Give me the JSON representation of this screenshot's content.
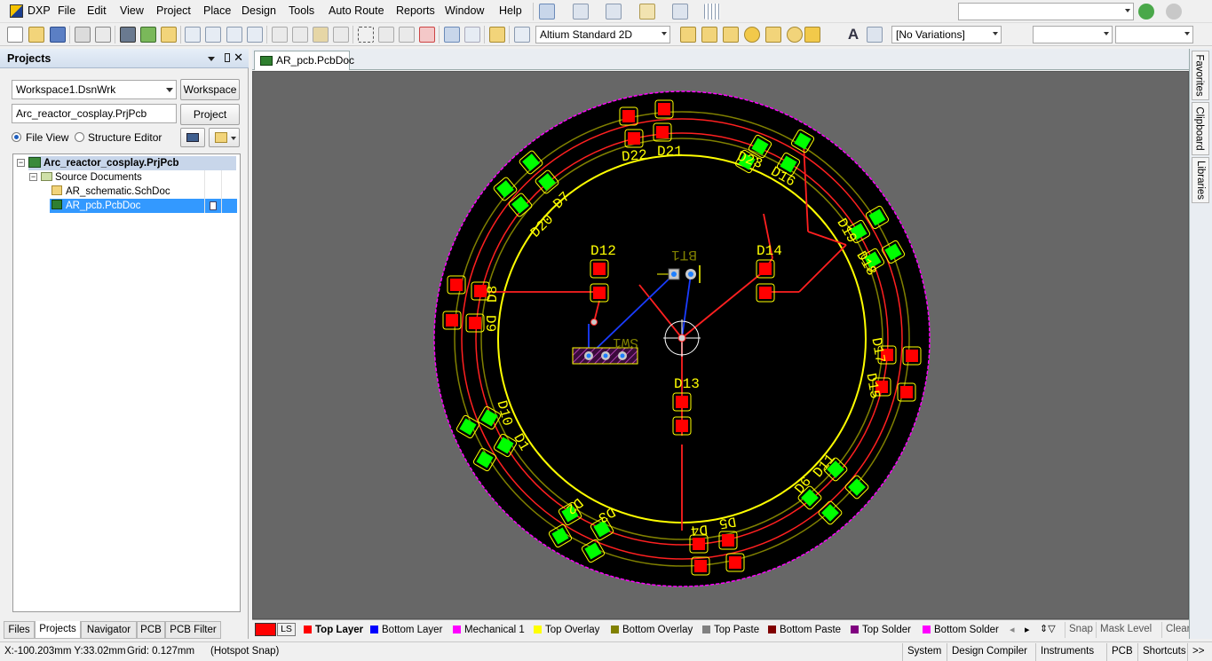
{
  "menubar": {
    "app_label": "DXP",
    "items": [
      "File",
      "Edit",
      "View",
      "Project",
      "Place",
      "Design",
      "Tools",
      "Auto Route",
      "Reports",
      "Window",
      "Help"
    ]
  },
  "toolbar": {
    "view_mode": "Altium Standard 2D",
    "variations": "[No Variations]"
  },
  "projects_panel": {
    "title": "Projects",
    "workspace_value": "Workspace1.DsnWrk",
    "workspace_button": "Workspace",
    "project_value": "Arc_reactor_cosplay.PrjPcb",
    "project_button": "Project",
    "file_view_label": "File View",
    "structure_editor_label": "Structure Editor",
    "tree": {
      "project": "Arc_reactor_cosplay.PrjPcb",
      "folder": "Source Documents",
      "schematic": "AR_schematic.SchDoc",
      "pcb": "AR_pcb.PcbDoc"
    },
    "tabs": [
      "Files",
      "Projects",
      "Navigator",
      "PCB",
      "PCB Filter"
    ],
    "active_tab": "Projects"
  },
  "document_tab": "AR_pcb.PcbDoc",
  "pcb": {
    "designators": {
      "D22": "D22",
      "D21": "D21",
      "D23": "D23",
      "D16": "D16",
      "D20": "D20",
      "D7": "D7",
      "D19": "D19",
      "D18": "D18",
      "D12": "D12",
      "BT1": "BT1",
      "D14": "D14",
      "D8": "D8",
      "D9": "D9",
      "SW1": "SW1",
      "D17": "D17",
      "D15": "D15",
      "D13": "D13",
      "D10": "D10",
      "D1": "D1",
      "D11": "D11",
      "D6": "D6",
      "D2": "D2",
      "D3": "D3",
      "D5": "D5",
      "D4": "D4"
    },
    "colors": {
      "board": "#000000",
      "outline": "#ff00ff",
      "top_layer": "#ff0000",
      "bottom_layer": "#0000ff",
      "overlay": "#ffff00",
      "bottom_overlay": "#808000",
      "pad_green": "#00ff00",
      "background": "#676767"
    }
  },
  "layer_tabs": {
    "ls_label": "LS",
    "layers": [
      {
        "name": "Top Layer",
        "color": "#ff0000"
      },
      {
        "name": "Bottom Layer",
        "color": "#0000ff"
      },
      {
        "name": "Mechanical 1",
        "color": "#ff00ff"
      },
      {
        "name": "Top Overlay",
        "color": "#ffff00"
      },
      {
        "name": "Bottom Overlay",
        "color": "#808000"
      },
      {
        "name": "Top Paste",
        "color": "#808080"
      },
      {
        "name": "Bottom Paste",
        "color": "#800000"
      },
      {
        "name": "Top Solder",
        "color": "#800080"
      },
      {
        "name": "Bottom Solder",
        "color": "#ff00ff"
      }
    ],
    "active_layer": "Top Layer",
    "snap": "Snap",
    "mask_level": "Mask Level",
    "clear": "Clear"
  },
  "right_panels": [
    "Favorites",
    "Clipboard",
    "Libraries"
  ],
  "statusbar": {
    "coords": "X:-100.203mm Y:33.02mm",
    "grid": "Grid: 0.127mm",
    "snap": "(Hotspot Snap)",
    "buttons": [
      "System",
      "Design Compiler",
      "Instruments",
      "PCB",
      "Shortcuts"
    ],
    "more": ">>"
  }
}
